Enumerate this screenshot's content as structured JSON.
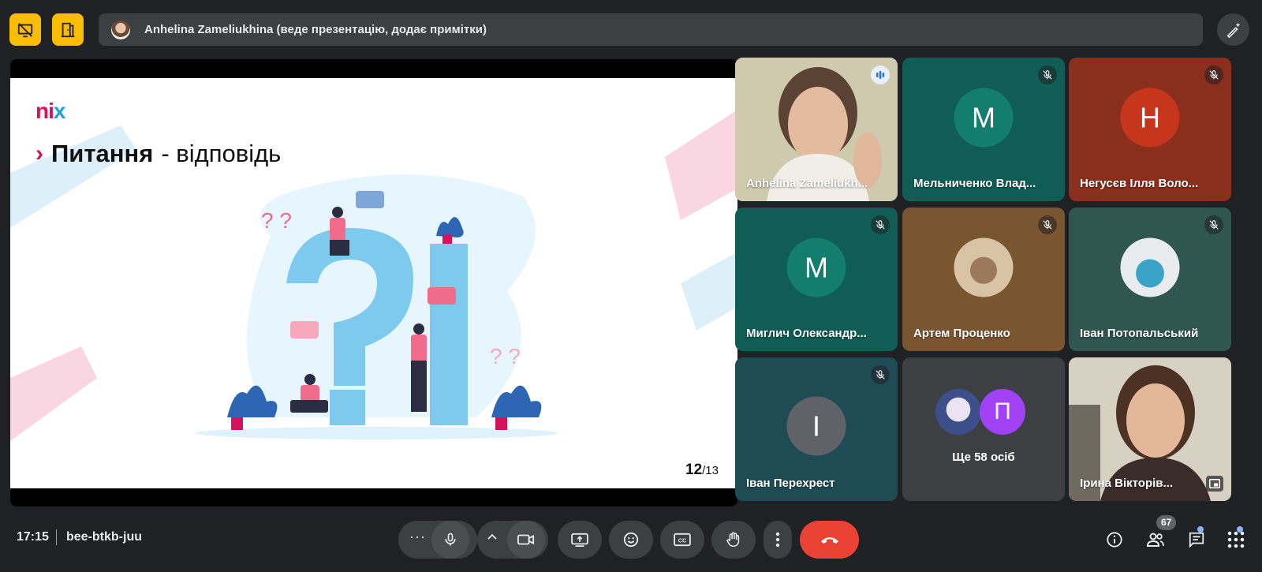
{
  "presenter_bar": {
    "text": "Anhelina Zameliukhina (веде презентацію, додає примітки)"
  },
  "slide": {
    "logo_left": "ni",
    "logo_right": "x",
    "title_bold": "Питання",
    "title_rest": "- відповідь",
    "page_current": "12",
    "page_total": "/13"
  },
  "participants": [
    {
      "name": "Anhelina Zameliukh...",
      "type": "video",
      "speaking": true
    },
    {
      "name": "Мельниченко Влад...",
      "letter": "М",
      "color": "#137d6e",
      "bg": "#0f5d55",
      "muted": true
    },
    {
      "name": "Негусєв Ілля Воло...",
      "letter": "Н",
      "color": "#c5361c",
      "bg": "#8a2f1c",
      "muted": true
    },
    {
      "name": "Миглич Олександр...",
      "letter": "М",
      "color": "#137d6e",
      "bg": "#0f5d55",
      "muted": true
    },
    {
      "name": "Артем Проценко",
      "type": "avatar-photo",
      "bg": "#7a5630",
      "muted": true
    },
    {
      "name": "Іван Потопальський",
      "type": "avatar-cartoon",
      "bg": "#2f5650",
      "muted": true
    },
    {
      "name": "Іван Перехрест",
      "letter": "І",
      "color": "#5f6368",
      "bg": "#1f4b55",
      "muted": true
    },
    {
      "name": "Ще 58 осіб",
      "letter": "П",
      "color": "#a142f4",
      "bg": "#3c4043"
    },
    {
      "name": "Ірина Вікторів...",
      "type": "video2"
    }
  ],
  "bottom_bar": {
    "time": "17:15",
    "meeting_code": "bee-btkb-juu",
    "participants_count": "67"
  },
  "colors": {
    "accent_yellow": "#fbbc04",
    "end_call_red": "#ea4335",
    "nix_pink": "#d4145a",
    "nix_blue": "#1fa2d8"
  }
}
